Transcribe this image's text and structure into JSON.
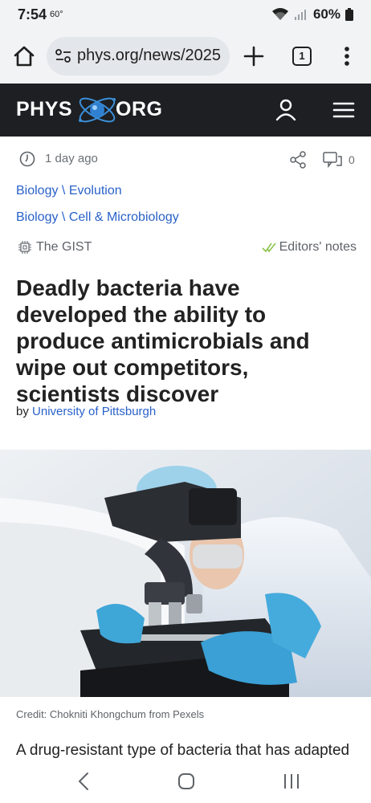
{
  "status": {
    "time": "7:54",
    "temperature": "60°",
    "battery": "60%"
  },
  "browser": {
    "url": "phys.org/news/2025",
    "tab_count": "1"
  },
  "site": {
    "logo_left": "PHYS",
    "logo_right": "ORG"
  },
  "article": {
    "time_ago": "1 day ago",
    "comment_count": "0",
    "categories": [
      "Biology \\ Evolution",
      "Biology \\ Cell & Microbiology"
    ],
    "gist_label": "The GIST",
    "editors_label": "Editors' notes",
    "headline": "Deadly bacteria have developed the ability to produce antimicrobials and wipe out competitors, scientists discover",
    "byline_prefix": "by ",
    "byline_author": "University of Pittsburgh",
    "photo_credit": "Credit: Chokniti Khongchum from Pexels",
    "body_start": "A drug-resistant type of bacteria that has adapted"
  },
  "colors": {
    "header_bg": "#1d1f23",
    "link": "#2a62c9",
    "browser_bg": "#f1f3f4",
    "check_green": "#8bc34a"
  },
  "icons": {
    "home": "home-icon",
    "site_settings": "site-settings-icon",
    "new_tab": "plus-icon",
    "tabs": "tab-switcher-icon",
    "menu": "more-vert-icon",
    "user": "user-icon",
    "hamburger": "hamburger-menu-icon",
    "clock": "clock-icon",
    "share": "share-icon",
    "comment": "comment-icon",
    "gist": "chip-icon",
    "editors": "check-icon"
  }
}
